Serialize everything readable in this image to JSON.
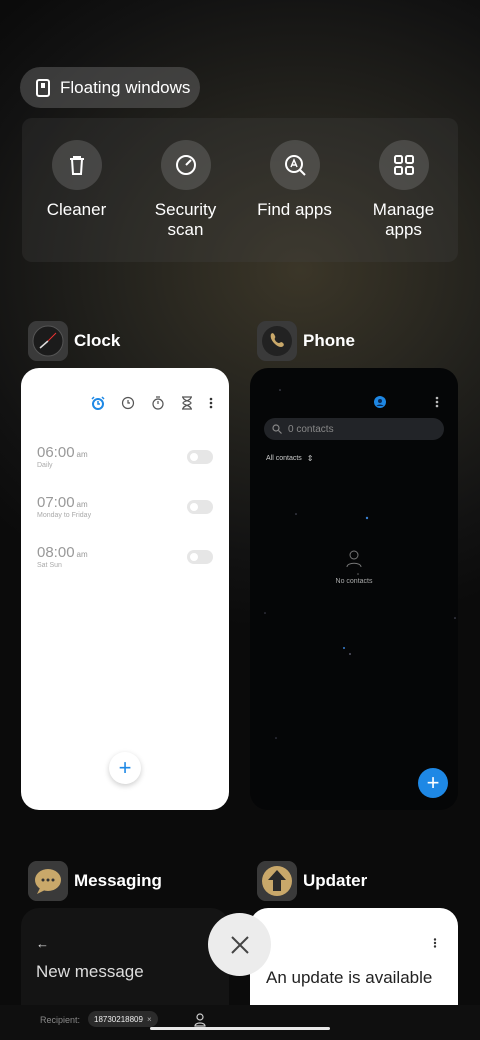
{
  "floating_windows": {
    "label": "Floating windows"
  },
  "quick_actions": [
    {
      "label": "Cleaner",
      "icon": "trash-icon"
    },
    {
      "label": "Security\nscan",
      "icon": "security-scan-icon"
    },
    {
      "label": "Find apps",
      "icon": "find-apps-icon"
    },
    {
      "label": "Manage\napps",
      "icon": "grid-icon"
    }
  ],
  "apps": {
    "clock": {
      "name": "Clock",
      "alarms": [
        {
          "time": "06:00",
          "ampm": "am",
          "repeat": "Daily"
        },
        {
          "time": "07:00",
          "ampm": "am",
          "repeat": "Monday to Friday"
        },
        {
          "time": "08:00",
          "ampm": "am",
          "repeat": "Sat Sun"
        }
      ],
      "fab_symbol": "+"
    },
    "phone": {
      "name": "Phone",
      "search_placeholder": "0 contacts",
      "filter_label": "All contacts",
      "empty_text": "No contacts",
      "fab_symbol": "+"
    },
    "messaging": {
      "name": "Messaging",
      "title": "New message",
      "recipient_label": "Recipient:",
      "recipient_number": "18730218809"
    },
    "updater": {
      "name": "Updater",
      "headline": "An update is available"
    }
  },
  "colors": {
    "accent_blue": "#1e88e5"
  }
}
